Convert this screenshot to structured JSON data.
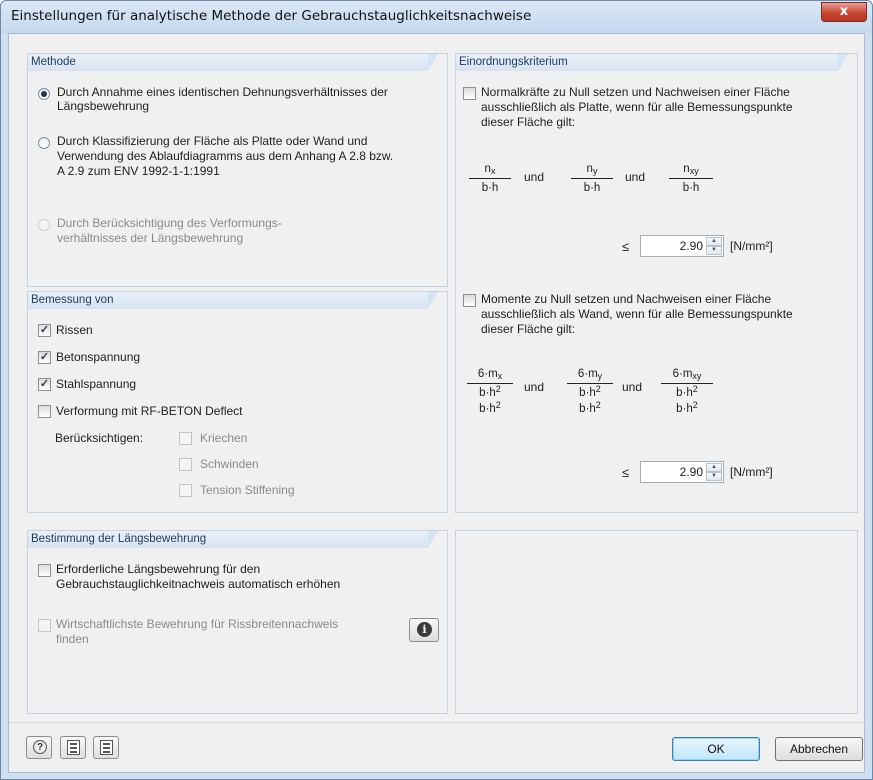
{
  "window": {
    "title": "Einstellungen für analytische Methode der Gebrauchstauglichkeitsnachweise",
    "close_glyph": "x"
  },
  "methode": {
    "header": "Methode",
    "options": [
      {
        "line1": "Durch Annahme eines identischen Dehnungsverhältnisses der",
        "line2": "Längsbewehrung",
        "selected": true,
        "enabled": true
      },
      {
        "line1": "Durch Klassifizierung der Fläche als Platte oder Wand und",
        "line2": "Verwendung des Ablaufdiagramms aus dem Anhang A 2.8 bzw.",
        "line3": "A 2.9 zum ENV 1992-1-1:1991",
        "selected": false,
        "enabled": true
      },
      {
        "line1": "Durch Berücksichtigung des Verformungs-",
        "line2": "verhältnisses der Längsbewehrung",
        "selected": false,
        "enabled": false
      }
    ]
  },
  "bemessung": {
    "header": "Bemessung von",
    "items": [
      {
        "label": "Rissen",
        "checked": true
      },
      {
        "label": "Betonspannung",
        "checked": true
      },
      {
        "label": "Stahlspannung",
        "checked": true
      },
      {
        "label": "Verformung mit RF-BETON Deflect",
        "checked": false
      }
    ],
    "consider_label": "Berücksichtigen:",
    "sub_items": [
      {
        "label": "Kriechen",
        "checked": false
      },
      {
        "label": "Schwinden",
        "checked": false
      },
      {
        "label": "Tension Stiffening",
        "checked": false
      }
    ]
  },
  "laengsbewehrung": {
    "header": "Bestimmung der Längsbewehrung",
    "opt1_line1": "Erforderliche Längsbewehrung für den",
    "opt1_line2": "Gebrauchstauglichkeitnachweis automatisch erhöhen",
    "opt2_line1": "Wirtschaftlichste Bewehrung für Rissbreitennachweis",
    "opt2_line2": "finden",
    "info_glyph": "i"
  },
  "kriterium": {
    "header": "Einordnungskriterium",
    "crit1": {
      "line1": "Normalkräfte zu Null setzen und Nachweisen einer Fläche",
      "line2": "ausschließlich als Platte, wenn für alle Bemessungspunkte",
      "line3": "dieser Fläche gilt:",
      "checked": false,
      "value": "2.90",
      "unit": "[N/mm²]"
    },
    "crit2": {
      "line1": "Momente zu Null setzen und Nachweisen einer Fläche",
      "line2": "ausschließlich als Wand, wenn für alle Bemessungspunkte",
      "line3": "dieser Fläche gilt:",
      "checked": false,
      "value": "2.90",
      "unit": "[N/mm²]"
    },
    "und": "und",
    "leq": "≤"
  },
  "buttons": {
    "ok": "OK",
    "cancel": "Abbrechen"
  },
  "icons": [
    "help-icon",
    "import-icon",
    "export-icon"
  ]
}
